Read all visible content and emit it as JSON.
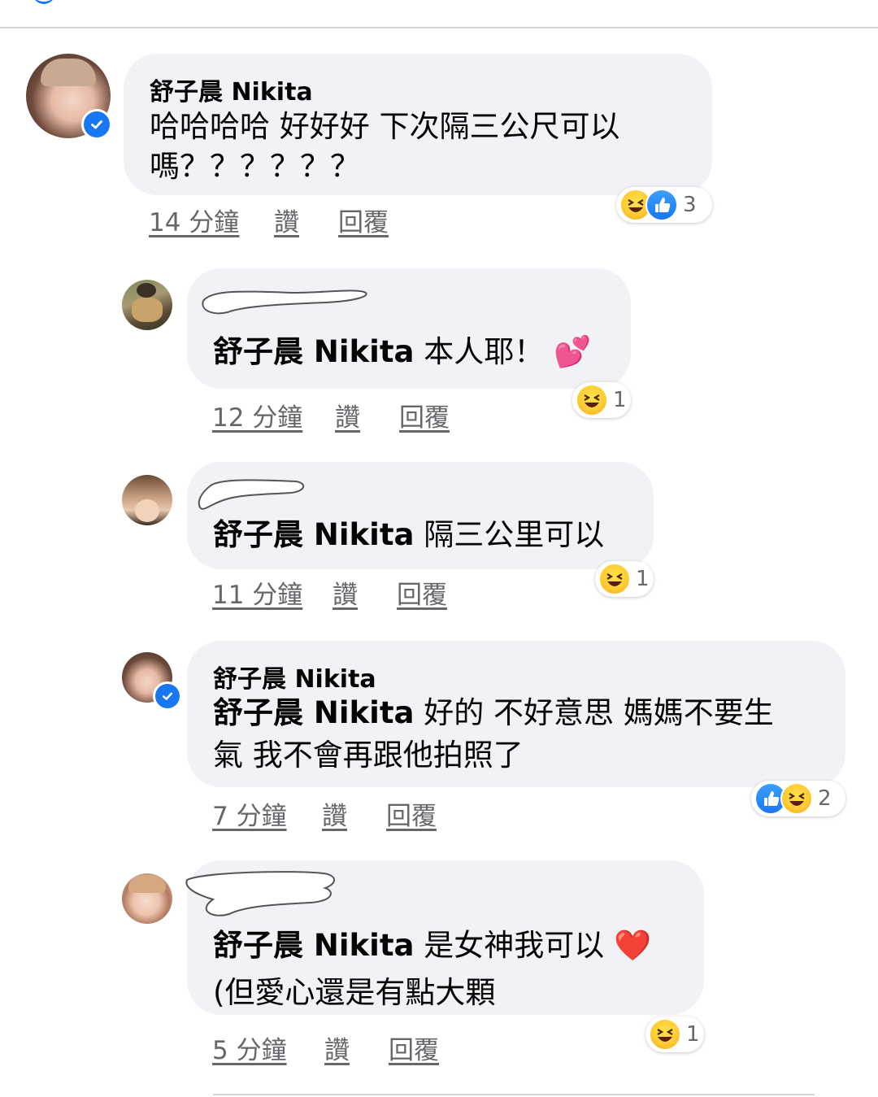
{
  "comments": [
    {
      "author": "舒子晨 Nikita",
      "verified": true,
      "mention": "",
      "lines": [
        "哈哈哈哈 好好好 下次隔三公尺可以",
        "嗎？？？？？？"
      ],
      "time": "14 分鐘",
      "like_label": "讚",
      "reply_label": "回覆",
      "reactions": [
        "haha-icon",
        "like-icon"
      ],
      "reaction_count": "3"
    },
    {
      "author": "",
      "author_hidden": true,
      "verified": false,
      "mention": "舒子晨 Nikita",
      "lines": [
        "本人耶！"
      ],
      "emoji": "💕",
      "time": "12 分鐘",
      "like_label": "讚",
      "reply_label": "回覆",
      "reactions": [
        "haha-icon"
      ],
      "reaction_count": "1"
    },
    {
      "author": "",
      "author_hidden": true,
      "verified": false,
      "mention": "舒子晨 Nikita",
      "lines": [
        "隔三公里可以"
      ],
      "time": "11 分鐘",
      "like_label": "讚",
      "reply_label": "回覆",
      "reactions": [
        "haha-icon"
      ],
      "reaction_count": "1"
    },
    {
      "author": "舒子晨 Nikita",
      "verified": true,
      "mention": "舒子晨 Nikita",
      "lines": [
        "好的 不好意思 媽媽不要生",
        "氣 我不會再跟他拍照了"
      ],
      "time": "7 分鐘",
      "like_label": "讚",
      "reply_label": "回覆",
      "reactions": [
        "like-icon",
        "haha-icon"
      ],
      "reaction_count": "2"
    },
    {
      "author": "",
      "author_hidden": true,
      "verified": false,
      "mention": "舒子晨 Nikita",
      "lines": [
        "是女神我可以",
        "(但愛心還是有點大顆"
      ],
      "emoji": "❤️",
      "time": "5 分鐘",
      "like_label": "讚",
      "reply_label": "回覆",
      "reactions": [
        "haha-icon"
      ],
      "reaction_count": "1"
    }
  ],
  "colors": {
    "bubble": "#f0f2f5",
    "meta_text": "#65676b",
    "verified": "#1877f2"
  }
}
